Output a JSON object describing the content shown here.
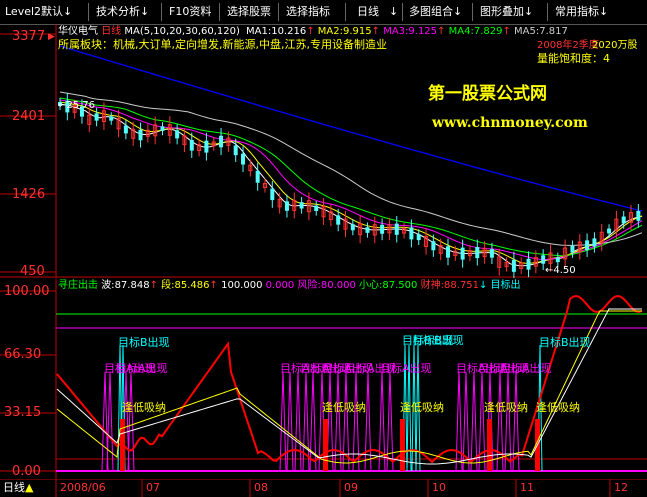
{
  "toolbar": {
    "items": [
      {
        "label": "Level2默认",
        "arrow": "↓"
      },
      {
        "label": "技术分析",
        "arrow": "↓"
      },
      {
        "label": "F10资料",
        "arrow": ""
      },
      {
        "label": "选择股票",
        "arrow": ""
      },
      {
        "label": "选择指标",
        "arrow": ""
      },
      {
        "label": "日线",
        "arrow": "↓"
      },
      {
        "label": "多图组合",
        "arrow": "↓"
      },
      {
        "label": "图形叠加",
        "arrow": "↓"
      },
      {
        "label": "常用指标",
        "arrow": "↓"
      }
    ]
  },
  "price_panel": {
    "stock_name": "华仪电气",
    "period": "日线",
    "ma_params": "MA(5,10,20,30,60,120)",
    "ma_values": [
      {
        "label": "MA1:",
        "value": "10.216",
        "arrow": "↑",
        "color": "#ffffff"
      },
      {
        "label": "MA2:",
        "value": "9.915",
        "arrow": "↑",
        "color": "#ffff00"
      },
      {
        "label": "MA3:",
        "value": "9.125",
        "arrow": "↑",
        "color": "#ff00ff"
      },
      {
        "label": "MA4:",
        "value": "7.829",
        "arrow": "↑",
        "color": "#00ff00"
      },
      {
        "label": "MA5:",
        "value": "7.817",
        "arrow": "↑",
        "color": "#cccccc"
      }
    ],
    "sector_text": "所属板块：机械,大订单,定向增发,新能源,中盘,江苏,专用设备制造业",
    "overlay_red_text": "2008年2季度",
    "overlay_yellow_text": "2020万股",
    "saturation_text": "量能饱和度：4",
    "watermark_title": "第一股票公式网",
    "watermark_url": "www.chnmoney.com",
    "y_labels": [
      "3377",
      "2401",
      "1426",
      "450"
    ],
    "high_label": "25.76",
    "low_label": "4.50"
  },
  "indicator": {
    "title": "寻庄出击",
    "values": [
      {
        "label": "波:",
        "value": "87.848",
        "arrow": "↑",
        "color": "#ffffff"
      },
      {
        "label": "段:",
        "value": "85.486",
        "arrow": "↑",
        "color": "#ffff00"
      },
      {
        "label": "",
        "value": "100.000",
        "arrow": "",
        "color": "#ffffff"
      },
      {
        "label": "",
        "value": "0.000",
        "arrow": "",
        "color": "#ff00ff"
      },
      {
        "label": "风险:",
        "value": "80.000",
        "arrow": "",
        "color": "#ff00ff"
      },
      {
        "label": "小心:",
        "value": "87.500",
        "arrow": "",
        "color": "#00ff00"
      },
      {
        "label": "财神:",
        "value": "88.751",
        "arrow": "↓",
        "color": "#ff3333"
      },
      {
        "label": "目标出",
        "value": "",
        "arrow": "",
        "color": "#00ffff"
      }
    ],
    "y_labels": [
      "100.00",
      "66.30",
      "33.15",
      "0.00"
    ],
    "signal_target_b": "目标B出现",
    "signal_target_a": "目标A出现",
    "signal_low_buy": "逢低吸纳"
  },
  "date_axis": {
    "period_label": "日线",
    "labels": [
      "2008/06",
      "07",
      "08",
      "09",
      "10",
      "11",
      "12"
    ]
  },
  "colors": {
    "up": "#ff3232",
    "down": "#54fcfc",
    "axis": "#c00000",
    "ma1": "#ffffff",
    "ma2": "#ffff00",
    "ma3": "#ff00ff",
    "ma4": "#00ff00",
    "ma5": "#cccccc",
    "ma6": "#0000ff"
  }
}
